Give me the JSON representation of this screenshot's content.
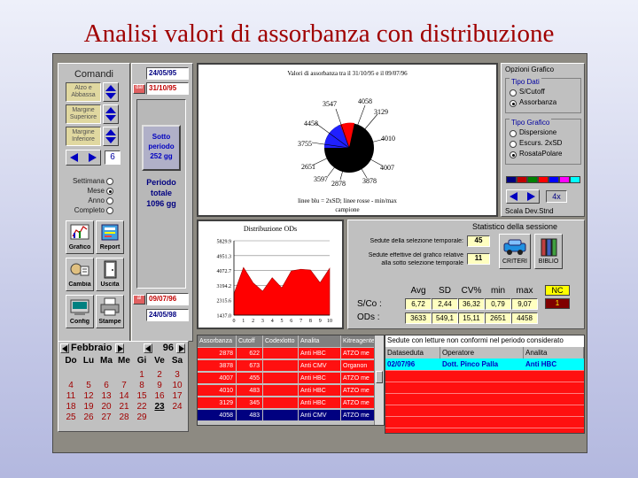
{
  "slide_title": "Analisi valori di assorbanza con distribuzione",
  "comandi": {
    "title": "Comandi",
    "alzo_label": "Alzo e Abbassa",
    "margine_sup_label": "Margine Superiore",
    "margine_inf_label": "Margine Inferiore",
    "counter": "6",
    "radios": [
      {
        "label": "Settimana",
        "checked": false
      },
      {
        "label": "Mese",
        "checked": true
      },
      {
        "label": "Anno",
        "checked": false
      },
      {
        "label": "Completo",
        "checked": false
      }
    ],
    "buttons": [
      "Grafico",
      "Report",
      "Cambia",
      "Uscita",
      "Config",
      "Stampe"
    ]
  },
  "dates": {
    "start_top": "24/05/95",
    "dal_label": "dal",
    "dal_value": "31/10/95",
    "al_label": "al",
    "al_value": "09/07/96",
    "end_bottom": "24/05/98"
  },
  "periodo": {
    "sotto_line1": "Sotto",
    "sotto_line2": "periodo",
    "sotto_line3": "252 gg",
    "totale_line1": "Periodo",
    "totale_line2": "totale",
    "totale_line3": "1096 gg"
  },
  "rose": {
    "caption_top": "Valori di assorbanza tra  il 31/10/95 e il 09/07/96",
    "labels": [
      "3547",
      "4058",
      "3129",
      "4010",
      "4007",
      "3878",
      "2878",
      "3597",
      "2651",
      "3755",
      "4458"
    ],
    "caption_bottom_1": "linee blu = 2xSD; linee rosse - min/max",
    "caption_bottom_2": "campione"
  },
  "opzioni": {
    "title": "Opzioni Grafico",
    "tipo_dati_title": "Tipo Dati",
    "tipo_dati": [
      {
        "label": "S/Cutoff",
        "checked": false
      },
      {
        "label": "Assorbanza",
        "checked": true
      }
    ],
    "tipo_grafico_title": "Tipo Grafico",
    "tipo_grafico": [
      {
        "label": "Dispersione",
        "checked": false
      },
      {
        "label": "Escurs. 2xSD",
        "checked": false
      },
      {
        "label": "RosataPolare",
        "checked": true
      }
    ],
    "swatches": [
      "#000080",
      "#c00000",
      "#008000",
      "#ff0000",
      "#0000ff",
      "#ff00ff",
      "#00ffff"
    ],
    "zoom": "4x",
    "scala_label": "Scala Dev.Stnd"
  },
  "chart_data": {
    "type": "line",
    "title": "Distribuzione ODs",
    "x": [
      0,
      1,
      2,
      3,
      4,
      5,
      6,
      7,
      8,
      9,
      10
    ],
    "series": [
      {
        "values": [
          2700,
          4250,
          3350,
          2850,
          3650,
          3050,
          4050,
          4150,
          4100,
          3350,
          4200
        ]
      }
    ],
    "y_ticks": [
      "5829.9",
      "4951.3",
      "4072.7",
      "3194.2",
      "2315.6",
      "1437.0"
    ],
    "ylim": [
      1437.0,
      5829.9
    ],
    "xlim": [
      0,
      10
    ],
    "grid": true,
    "area_color": "#ff0000"
  },
  "statistico": {
    "title": "Statistico della sessione",
    "sel_label": "Sedute della selezione temporale:",
    "sel_value": "45",
    "eff_label_1": "Sedute effettive del grafico relative",
    "eff_label_2": "alla sotto selezione temporale",
    "eff_value": "11",
    "criteri": "CRITERI",
    "biblio": "BIBLIO",
    "headers": [
      "Avg",
      "SD",
      "CV%",
      "min",
      "max",
      "NC"
    ],
    "sco_label": "S/Co :",
    "sco_values": [
      "6,72",
      "2,44",
      "36,32",
      "0,79",
      "9,07",
      "1"
    ],
    "ods_label": "ODs :",
    "ods_values": [
      "3633",
      "549,1",
      "15,11",
      "2651",
      "4458"
    ]
  },
  "calendar": {
    "month": "Febbraio",
    "year": "96",
    "weekdays": [
      "Do",
      "Lu",
      "Ma",
      "Me",
      "Gi",
      "Ve",
      "Sa"
    ],
    "weeks": [
      [
        "",
        "",
        "",
        "",
        "1",
        "2",
        "3"
      ],
      [
        "4",
        "5",
        "6",
        "7",
        "8",
        "9",
        "10"
      ],
      [
        "11",
        "12",
        "13",
        "14",
        "15",
        "16",
        "17"
      ],
      [
        "18",
        "19",
        "20",
        "21",
        "22",
        "23",
        "24"
      ],
      [
        "25",
        "26",
        "27",
        "28",
        "29",
        "",
        ""
      ]
    ],
    "selected": "23"
  },
  "table": {
    "headers": [
      "Assorbanza",
      "Cutoff",
      "Codexlotto",
      "Analita",
      "Kitreagente"
    ],
    "rows": [
      [
        "2878",
        "622",
        "",
        "Anti HBC",
        "ATZO me"
      ],
      [
        "3878",
        "673",
        "",
        "Anti CMV",
        "Organon"
      ],
      [
        "4007",
        "455",
        "",
        "Anti HBC",
        "ATZO me"
      ],
      [
        "4010",
        "483",
        "",
        "Anti HBC",
        "ATZO me"
      ],
      [
        "3129",
        "345",
        "",
        "Anti HBC",
        "ATZO me"
      ],
      [
        "4058",
        "483",
        "",
        "Anti CMV",
        "ATZO me"
      ]
    ],
    "selected_row": 5
  },
  "sedute": {
    "title": "Sedute con letture non conformi nel periodo considerato",
    "headers": [
      "Dataseduta",
      "Operatore",
      "Analita"
    ],
    "rows": [
      [
        "02/07/96",
        "Dott. Pinco Palla",
        "Anti HBC"
      ]
    ]
  }
}
